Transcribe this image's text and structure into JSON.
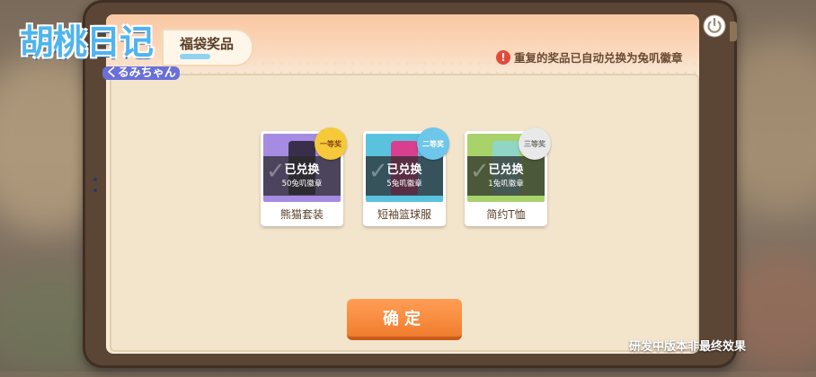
{
  "logo": {
    "title": "胡桃日记",
    "subtitle": "くるみちゃん"
  },
  "header": {
    "title": "福袋奖品"
  },
  "notice": {
    "icon": "exclamation-icon",
    "text": "重复的奖品已自动兑换为兔叽徽章"
  },
  "rewards": [
    {
      "rank": "一等奖",
      "status": "已兑换",
      "exchange": "50兔叽徽章",
      "name": "熊猫套装",
      "badge_color": "#f6c93a",
      "art_color": "#a58be2",
      "shirt_color": "#3a2f4a"
    },
    {
      "rank": "二等奖",
      "status": "已兑换",
      "exchange": "5兔叽徽章",
      "name": "短袖篮球服",
      "badge_color": "#6ec6ea",
      "art_color": "#59c3df",
      "shirt_color": "#d83f8e"
    },
    {
      "rank": "三等奖",
      "status": "已兑换",
      "exchange": "1兔叽徽章",
      "name": "简约T恤",
      "badge_color": "#e9e9e9",
      "art_color": "#a8d36a",
      "shirt_color": "#8fd6c7"
    }
  ],
  "confirm_button": {
    "label": "确定"
  },
  "watermark": {
    "text": "研发中版本非最终效果"
  }
}
